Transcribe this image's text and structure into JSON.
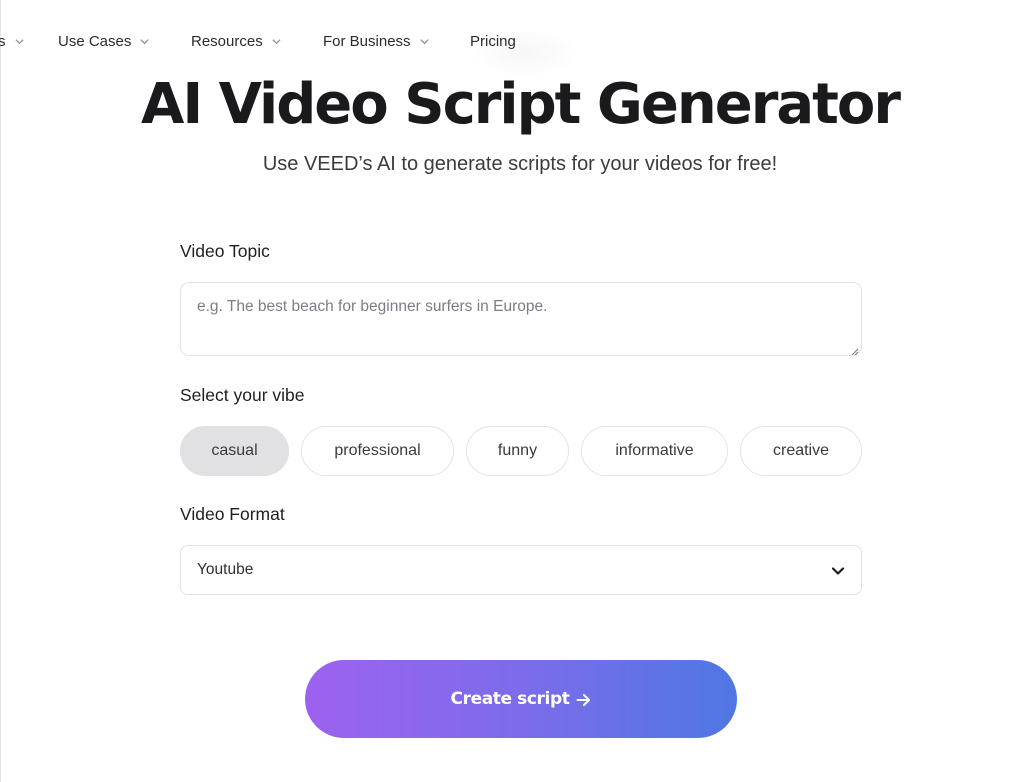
{
  "nav": {
    "items": [
      {
        "label": "s",
        "has_dropdown": true
      },
      {
        "label": "Use Cases",
        "has_dropdown": true
      },
      {
        "label": "Resources",
        "has_dropdown": true
      },
      {
        "label": "For Business",
        "has_dropdown": true
      },
      {
        "label": "Pricing",
        "has_dropdown": false
      }
    ]
  },
  "hero": {
    "title": "AI Video Script Generator",
    "subtitle": "Use VEED’s AI to generate scripts for your videos for free!"
  },
  "form": {
    "topic": {
      "label": "Video Topic",
      "value": "",
      "placeholder": "e.g. The best beach for beginner surfers in Europe."
    },
    "vibe": {
      "label": "Select your vibe",
      "selected": "casual",
      "options": [
        "casual",
        "professional",
        "funny",
        "informative",
        "creative"
      ]
    },
    "format": {
      "label": "Video Format",
      "selected": "Youtube",
      "icon": "chevron-down-icon"
    },
    "submit": {
      "label": "Create script",
      "icon": "arrow-right-icon",
      "gradient_start": "#9d62ef",
      "gradient_end": "#4f77e4"
    }
  }
}
